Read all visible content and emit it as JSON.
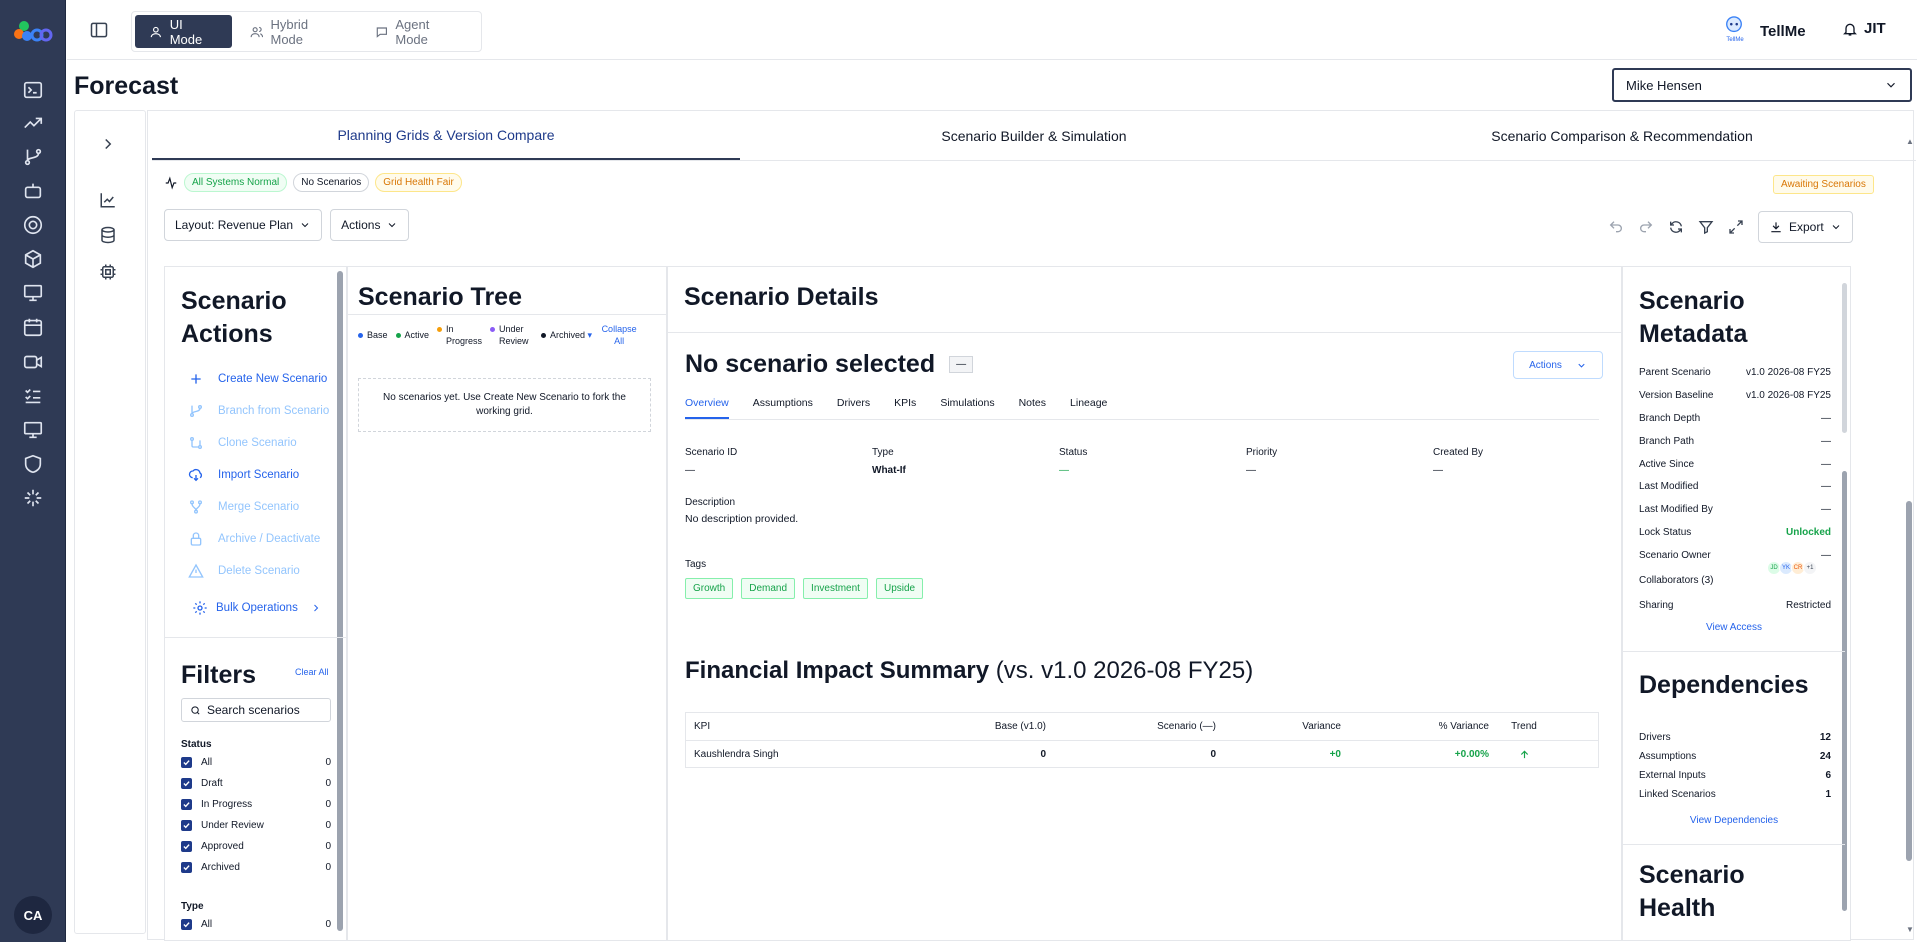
{
  "topbar": {
    "modes": [
      {
        "label": "UI Mode",
        "active": true
      },
      {
        "label": "Hybrid Mode"
      },
      {
        "label": "Agent Mode"
      }
    ],
    "tellme_label": "TellMe",
    "tellme_badge": "TellMe",
    "jit_label": "JIT"
  },
  "page_title": "Forecast",
  "user_select": {
    "value": "Mike Hensen"
  },
  "avatar_initials": "CA",
  "tabs": [
    "Planning Grids & Version Compare",
    "Scenario Builder & Simulation",
    "Scenario Comparison & Recommendation"
  ],
  "status": {
    "systems": "All Systems Normal",
    "scenarios": "No Scenarios",
    "grid_health": "Grid Health Fair",
    "awaiting": "Awaiting Scenarios"
  },
  "toolbar": {
    "layout": "Layout: Revenue Plan",
    "actions": "Actions",
    "export": "Export"
  },
  "scenario_actions": {
    "title": "Scenario Actions",
    "items": [
      "Create New Scenario",
      "Branch from Scenario",
      "Clone Scenario",
      "Import Scenario",
      "Merge Scenario",
      "Archive / Deactivate",
      "Delete Scenario"
    ],
    "bulk": "Bulk Operations"
  },
  "filters": {
    "title": "Filters",
    "clear": "Clear All",
    "search_placeholder": "Search scenarios",
    "status_title": "Status",
    "status": [
      {
        "label": "All",
        "count": "0"
      },
      {
        "label": "Draft",
        "count": "0"
      },
      {
        "label": "In Progress",
        "count": "0"
      },
      {
        "label": "Under Review",
        "count": "0"
      },
      {
        "label": "Approved",
        "count": "0"
      },
      {
        "label": "Archived",
        "count": "0"
      }
    ],
    "type_title": "Type",
    "type": [
      {
        "label": "All",
        "count": "0"
      }
    ]
  },
  "tree": {
    "title": "Scenario Tree",
    "legend": [
      {
        "label": "Base",
        "color": "#2563eb"
      },
      {
        "label": "Active",
        "color": "#16a34a"
      },
      {
        "label": "In Progress",
        "color": "#f59e0b"
      },
      {
        "label": "Under Review",
        "color": "#8b5cf6"
      },
      {
        "label": "Archived",
        "color": "#111827"
      }
    ],
    "collapse": "Collapse All",
    "empty": "No scenarios yet. Use Create New Scenario to fork the working grid."
  },
  "details": {
    "title": "Scenario Details",
    "heading": "No scenario selected",
    "badge": "—",
    "actions": "Actions",
    "tabs": [
      "Overview",
      "Assumptions",
      "Drivers",
      "KPIs",
      "Simulations",
      "Notes",
      "Lineage"
    ],
    "fields": [
      {
        "label": "Scenario ID",
        "value": "—"
      },
      {
        "label": "Type",
        "value": "What-If"
      },
      {
        "label": "Status",
        "value": "—"
      },
      {
        "label": "Priority",
        "value": "—"
      },
      {
        "label": "Created By",
        "value": "—"
      }
    ],
    "description_label": "Description",
    "description": "No description provided.",
    "tags_label": "Tags",
    "tags": [
      "Growth",
      "Demand",
      "Investment",
      "Upside"
    ],
    "impact_title": "Financial Impact Summary",
    "impact_sub": "(vs. v1.0 2026-08 FY25)",
    "kpi_headers": [
      "KPI",
      "Base (v1.0)",
      "Scenario (—)",
      "Variance",
      "% Variance",
      "Trend"
    ],
    "kpi_rows": [
      {
        "kpi": "Kaushlendra Singh",
        "base": "0",
        "scenario": "0",
        "variance": "+0",
        "pct": "+0.00%"
      }
    ]
  },
  "metadata": {
    "title": "Scenario Metadata",
    "rows": [
      {
        "label": "Parent Scenario",
        "value": "v1.0 2026-08 FY25"
      },
      {
        "label": "Version Baseline",
        "value": "v1.0 2026-08 FY25"
      },
      {
        "label": "Branch Depth",
        "value": "—"
      },
      {
        "label": "Branch Path",
        "value": "—"
      },
      {
        "label": "Active Since",
        "value": "—"
      },
      {
        "label": "Last Modified",
        "value": "—"
      },
      {
        "label": "Last Modified By",
        "value": "—"
      },
      {
        "label": "Lock Status",
        "value": "Unlocked"
      },
      {
        "label": "Scenario Owner",
        "value": "—"
      },
      {
        "label": "Collaborators (3)",
        "value": ""
      },
      {
        "label": "Sharing",
        "value": "Restricted"
      }
    ],
    "collaborators": [
      "JD",
      "YK",
      "CR",
      "+1"
    ],
    "view_access": "View Access"
  },
  "dependencies": {
    "title": "Dependencies",
    "rows": [
      {
        "label": "Drivers",
        "value": "12"
      },
      {
        "label": "Assumptions",
        "value": "24"
      },
      {
        "label": "External Inputs",
        "value": "6"
      },
      {
        "label": "Linked Scenarios",
        "value": "1"
      }
    ],
    "link": "View Dependencies"
  },
  "health": {
    "title": "Scenario Health"
  }
}
